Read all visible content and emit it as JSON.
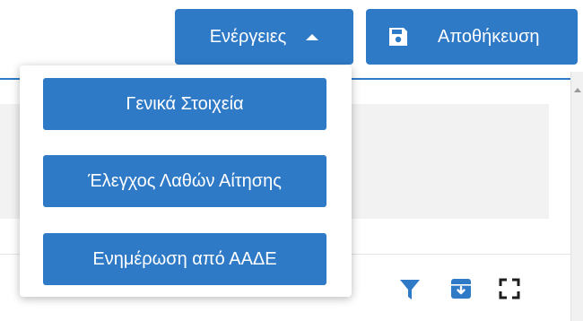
{
  "toolbar": {
    "actions_label": "Ενέργειες",
    "save_label": "Αποθήκευση"
  },
  "actions_menu": {
    "items": [
      {
        "label": "Γενικά Στοιχεία"
      },
      {
        "label": "Έλεγχος Λαθών Αίτησης"
      },
      {
        "label": "Ενημέρωση από ΑΑΔΕ"
      }
    ]
  },
  "panel_tools": {
    "icons": [
      "filter-icon",
      "archive-download-icon",
      "fullscreen-icon"
    ]
  },
  "colors": {
    "primary": "#2f7ac7",
    "panel_background": "#f2f2f2"
  }
}
